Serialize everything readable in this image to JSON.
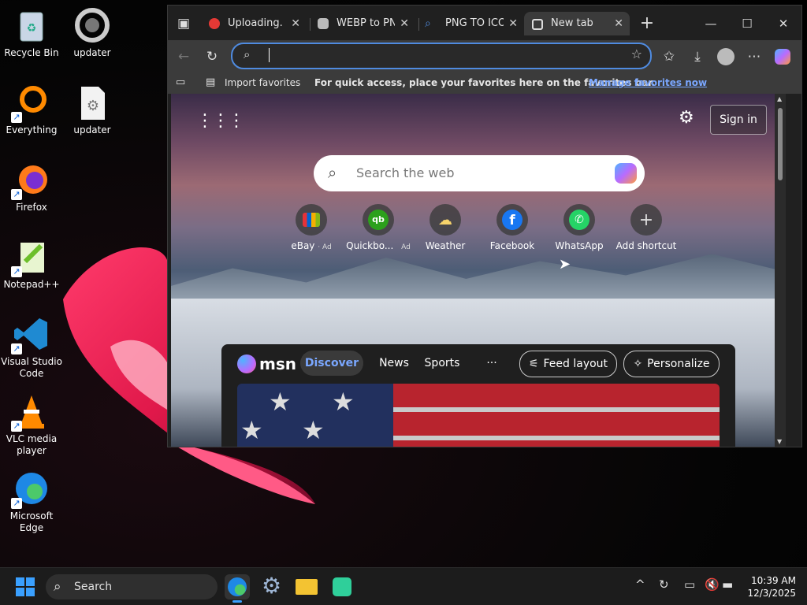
{
  "desktop": {
    "icons": [
      {
        "label": "Recycle Bin"
      },
      {
        "label": "updater"
      },
      {
        "label": "Everything"
      },
      {
        "label": "updater"
      },
      {
        "label": "Firefox"
      },
      {
        "label": "Notepad++"
      },
      {
        "label": "Visual Studio Code"
      },
      {
        "label": "VLC media player"
      },
      {
        "label": "Microsoft Edge"
      }
    ]
  },
  "browser": {
    "tabs": [
      {
        "title": "Uploading... —",
        "icon": "upload-site-icon",
        "color": "#e53935"
      },
      {
        "title": "WEBP to PNG",
        "icon": "convert-site-icon",
        "color": "#e0e0e0"
      },
      {
        "title": "PNG TO ICON",
        "icon": "search-icon",
        "color": "#4f8be0"
      },
      {
        "title": "New tab",
        "icon": "newtab-icon",
        "color": "#e6e6e6"
      }
    ],
    "address": {
      "value": ""
    },
    "favorites_bar": {
      "import_label": "Import favorites",
      "hint": "For quick access, place your favorites here on the favorites bar.",
      "manage_link": "Manage favorites now"
    },
    "newtab": {
      "search_placeholder": "Search the web",
      "sign_in": "Sign in",
      "shortcuts": [
        {
          "label": "eBay",
          "ad": "· Ad"
        },
        {
          "label": "Quickbo...",
          "ad": "Ad"
        },
        {
          "label": "Weather",
          "ad": ""
        },
        {
          "label": "Facebook",
          "ad": ""
        },
        {
          "label": "WhatsApp",
          "ad": ""
        },
        {
          "label": "Add shortcut",
          "ad": ""
        }
      ],
      "feed": {
        "brand": "msn",
        "tabs": [
          "Discover",
          "News",
          "Sports",
          "···"
        ],
        "feed_layout": "Feed layout",
        "personalize": "Personalize"
      }
    }
  },
  "taskbar": {
    "search_label": "Search",
    "time": "10:39 AM",
    "date": "12/3/2025"
  },
  "colors": {
    "accent": "#4f8be0",
    "link": "#7aa7ff",
    "discover_pill": "#3a3a3a"
  }
}
